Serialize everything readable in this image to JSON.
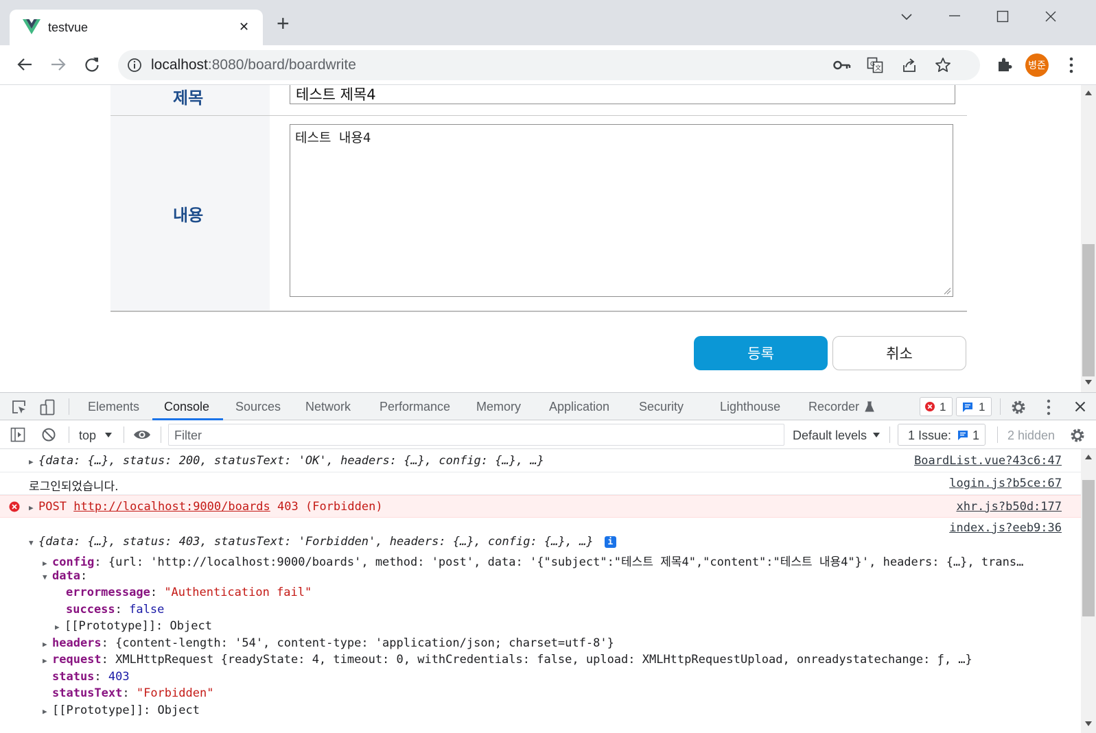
{
  "browser": {
    "tab_title": "testvue",
    "tab_close": "✕",
    "new_tab": "+",
    "url_host": "localhost",
    "url_rest": ":8080/board/boardwrite",
    "avatar": "병준"
  },
  "form": {
    "subject_label": "제목",
    "subject_value": "테스트 제목4",
    "content_label": "내용",
    "content_value": "테스트 내용4",
    "submit_label": "등록",
    "cancel_label": "취소"
  },
  "devtools": {
    "tabs": [
      "Elements",
      "Console",
      "Sources",
      "Network",
      "Performance",
      "Memory",
      "Application",
      "Security",
      "Lighthouse",
      "Recorder"
    ],
    "active_tab": "Console",
    "error_count": "1",
    "message_count": "1",
    "context": "top",
    "filter_placeholder": "Filter",
    "levels": "Default levels",
    "issues_label": "1 Issue:",
    "issues_count": "1",
    "hidden_label": "2 hidden"
  },
  "console": {
    "row1": {
      "text": "{data: {…}, status: 200, statusText: 'OK', headers: {…}, config: {…}, …}",
      "source": "BoardList.vue?43c6:47"
    },
    "row2": {
      "text": "로그인되었습니다.",
      "source": "login.js?b5ce:67"
    },
    "row3": {
      "method": "POST",
      "url": "http://localhost:9000/boards",
      "status": "403 (Forbidden)",
      "source": "xhr.js?b50d:177"
    },
    "row4_source": "index.js?eeb9:36",
    "expanded": {
      "summary": "{data: {…}, status: 403, statusText: 'Forbidden', headers: {…}, config: {…}, …}",
      "info_badge": "i",
      "config_key": "config",
      "config_val": ": {url: 'http://localhost:9000/boards', method: 'post', data: '{\"subject\":\"테스트 제목4\",\"content\":\"테스트 내용4\"}', headers: {…}, trans…",
      "data_key": "data",
      "errormessage_key": "errormessage",
      "errormessage_val": "\"Authentication fail\"",
      "success_key": "success",
      "success_val": "false",
      "proto1": "[[Prototype]]: Object",
      "headers_key": "headers",
      "headers_val": ": {content-length: '54', content-type: 'application/json; charset=utf-8'}",
      "request_key": "request",
      "request_val": ": XMLHttpRequest {readyState: 4, timeout: 0, withCredentials: false, upload: XMLHttpRequestUpload, onreadystatechange: ƒ, …}",
      "status_key": "status",
      "status_val": "403",
      "statustext_key": "statusText",
      "statustext_val": "\"Forbidden\"",
      "proto2": "[[Prototype]]: Object"
    }
  },
  "colors": {
    "accent_blue": "#1a73e8",
    "submit_button": "#0b97d6",
    "avatar": "#e8710a",
    "error_red": "#e3242b"
  }
}
